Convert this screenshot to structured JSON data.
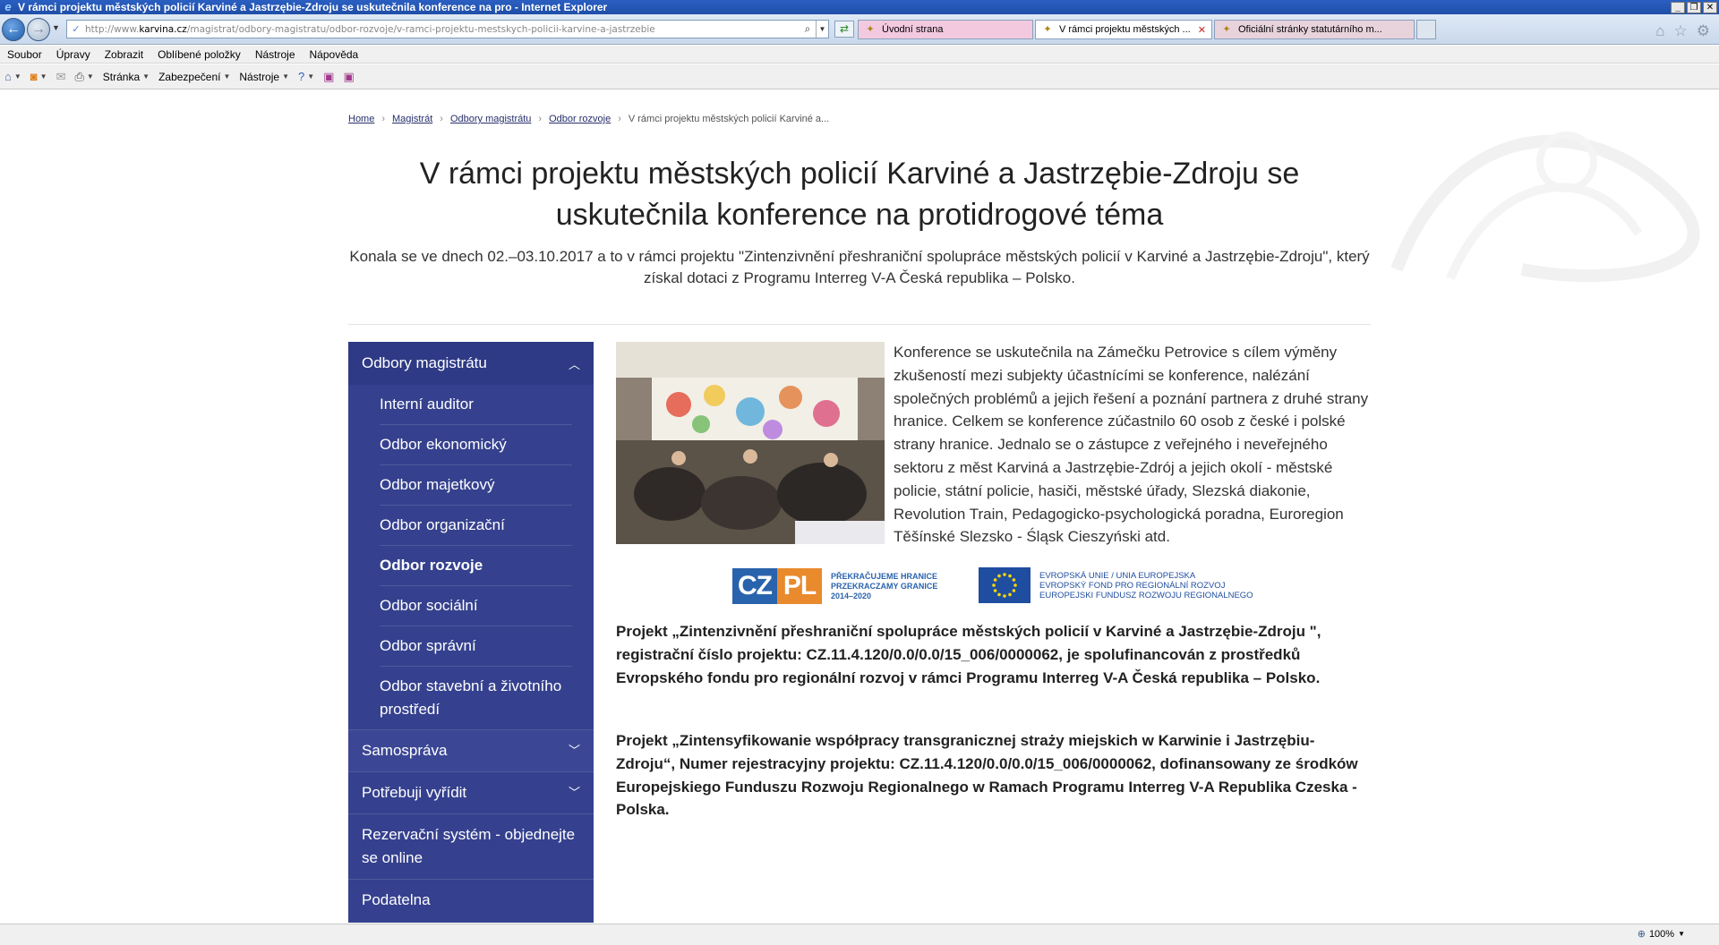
{
  "window": {
    "title": "V rámci projektu městských policií Karviné a Jastrzębie-Zdroju se uskutečnila konference na pro - Internet Explorer"
  },
  "address": {
    "prefix": "http://www.",
    "domain": "karvina.cz",
    "path": "/magistrat/odbory-magistratu/odbor-rozvoje/v-ramci-projektu-mestskych-policii-karvine-a-jastrzebie"
  },
  "tabs": [
    {
      "label": "Úvodní strana"
    },
    {
      "label": "V rámci projektu městských ..."
    },
    {
      "label": "Oficiální stránky statutárního m..."
    }
  ],
  "menu": {
    "items": [
      "Soubor",
      "Úpravy",
      "Zobrazit",
      "Oblíbené položky",
      "Nástroje",
      "Nápověda"
    ]
  },
  "commandbar": {
    "page": "Stránka",
    "security": "Zabezpečení",
    "tools": "Nástroje"
  },
  "breadcrumb": {
    "items": [
      "Home",
      "Magistrát",
      "Odbory magistrátu",
      "Odbor rozvoje"
    ],
    "current": "V rámci projektu městských policií Karviné a..."
  },
  "article": {
    "title": "V rámci projektu městských policií Karviné a Jastrzębie-Zdroju se uskutečnila konference na protidrogové téma",
    "lead": "Konala se ve dnech 02.–03.10.2017 a to v rámci projektu \"Zintenzivnění přeshraniční spolupráce městských policií v Karviné a Jastrzębie-Zdroju\", který získal dotaci z Programu Interreg V-A Česká republika – Polsko.",
    "body": "Konference se uskutečnila na Zámečku Petrovice s cílem výměny zkušeností mezi subjekty účastnícími se konference, nalézání společných problémů a jejich řešení a poznání partnera z druhé strany hranice. Celkem se konference zúčastnilo 60 osob z české i polské strany hranice. Jednalo se o zástupce z veřejného i neveřejného sektoru z měst Karviná a Jastrzębie-Zdrój a jejich okolí - městské policie, státní policie, hasiči, městské úřady, Slezská diakonie, Revolution Train, Pedagogicko-psychologická poradna, Euroregion Těšínské Slezsko - Śląsk Cieszyński atd.",
    "project_cz": "Projekt „Zintenzivnění přeshraniční spolupráce městských policií v Karviné a Jastrzębie-Zdroju \", registrační číslo projektu: CZ.11.4.120/0.0/0.0/15_006/0000062, je spolufinancován z prostředků Evropského fondu pro regionální rozvoj v rámci Programu Interreg V-A Česká republika – Polsko.",
    "project_pl": "Projekt „Zintensyfikowanie współpracy transgranicznej straży miejskich w Karwinie i Jastrzębiu-Zdroju“, Numer rejestracyjny projektu: CZ.11.4.120/0.0/0.0/15_006/0000062, dofinansowany ze środków Europejskiego Funduszu Rozwoju Regionalnego w Ramach Programu Interreg V-A Republika Czeska - Polska."
  },
  "logos": {
    "czpl_cz": "CZ",
    "czpl_pl": "PL",
    "czpl_lines": [
      "PŘEKRAČUJEME HRANICE",
      "PRZEKRACZAMY GRANICE",
      "2014–2020"
    ],
    "eu_lines": [
      "EVROPSKÁ UNIE / UNIA EUROPEJSKA",
      "EVROPSKÝ FOND PRO REGIONÁLNÍ ROZVOJ",
      "EUROPEJSKI FUNDUSZ ROZWOJU REGIONALNEGO"
    ]
  },
  "sidebar": {
    "section": "Odbory magistrátu",
    "items": [
      "Interní auditor",
      "Odbor ekonomický",
      "Odbor majetkový",
      "Odbor organizační",
      "Odbor rozvoje",
      "Odbor sociální",
      "Odbor správní",
      "Odbor stavební a životního prostředí"
    ],
    "active_item": "Odbor rozvoje",
    "top_items": [
      "Samospráva",
      "Potřebuji vyřídit",
      "Rezervační systém - objednejte se online",
      "Podatelna"
    ]
  },
  "status": {
    "zoom": "100%"
  },
  "colors": {
    "sidebar": "#35418e",
    "sidebar_header": "#2e3a85",
    "breadcrumb_link": "#27306b",
    "czpl_blue": "#2a63ad",
    "czpl_orange": "#e98a2d",
    "eu_blue": "#1f4ea0"
  }
}
